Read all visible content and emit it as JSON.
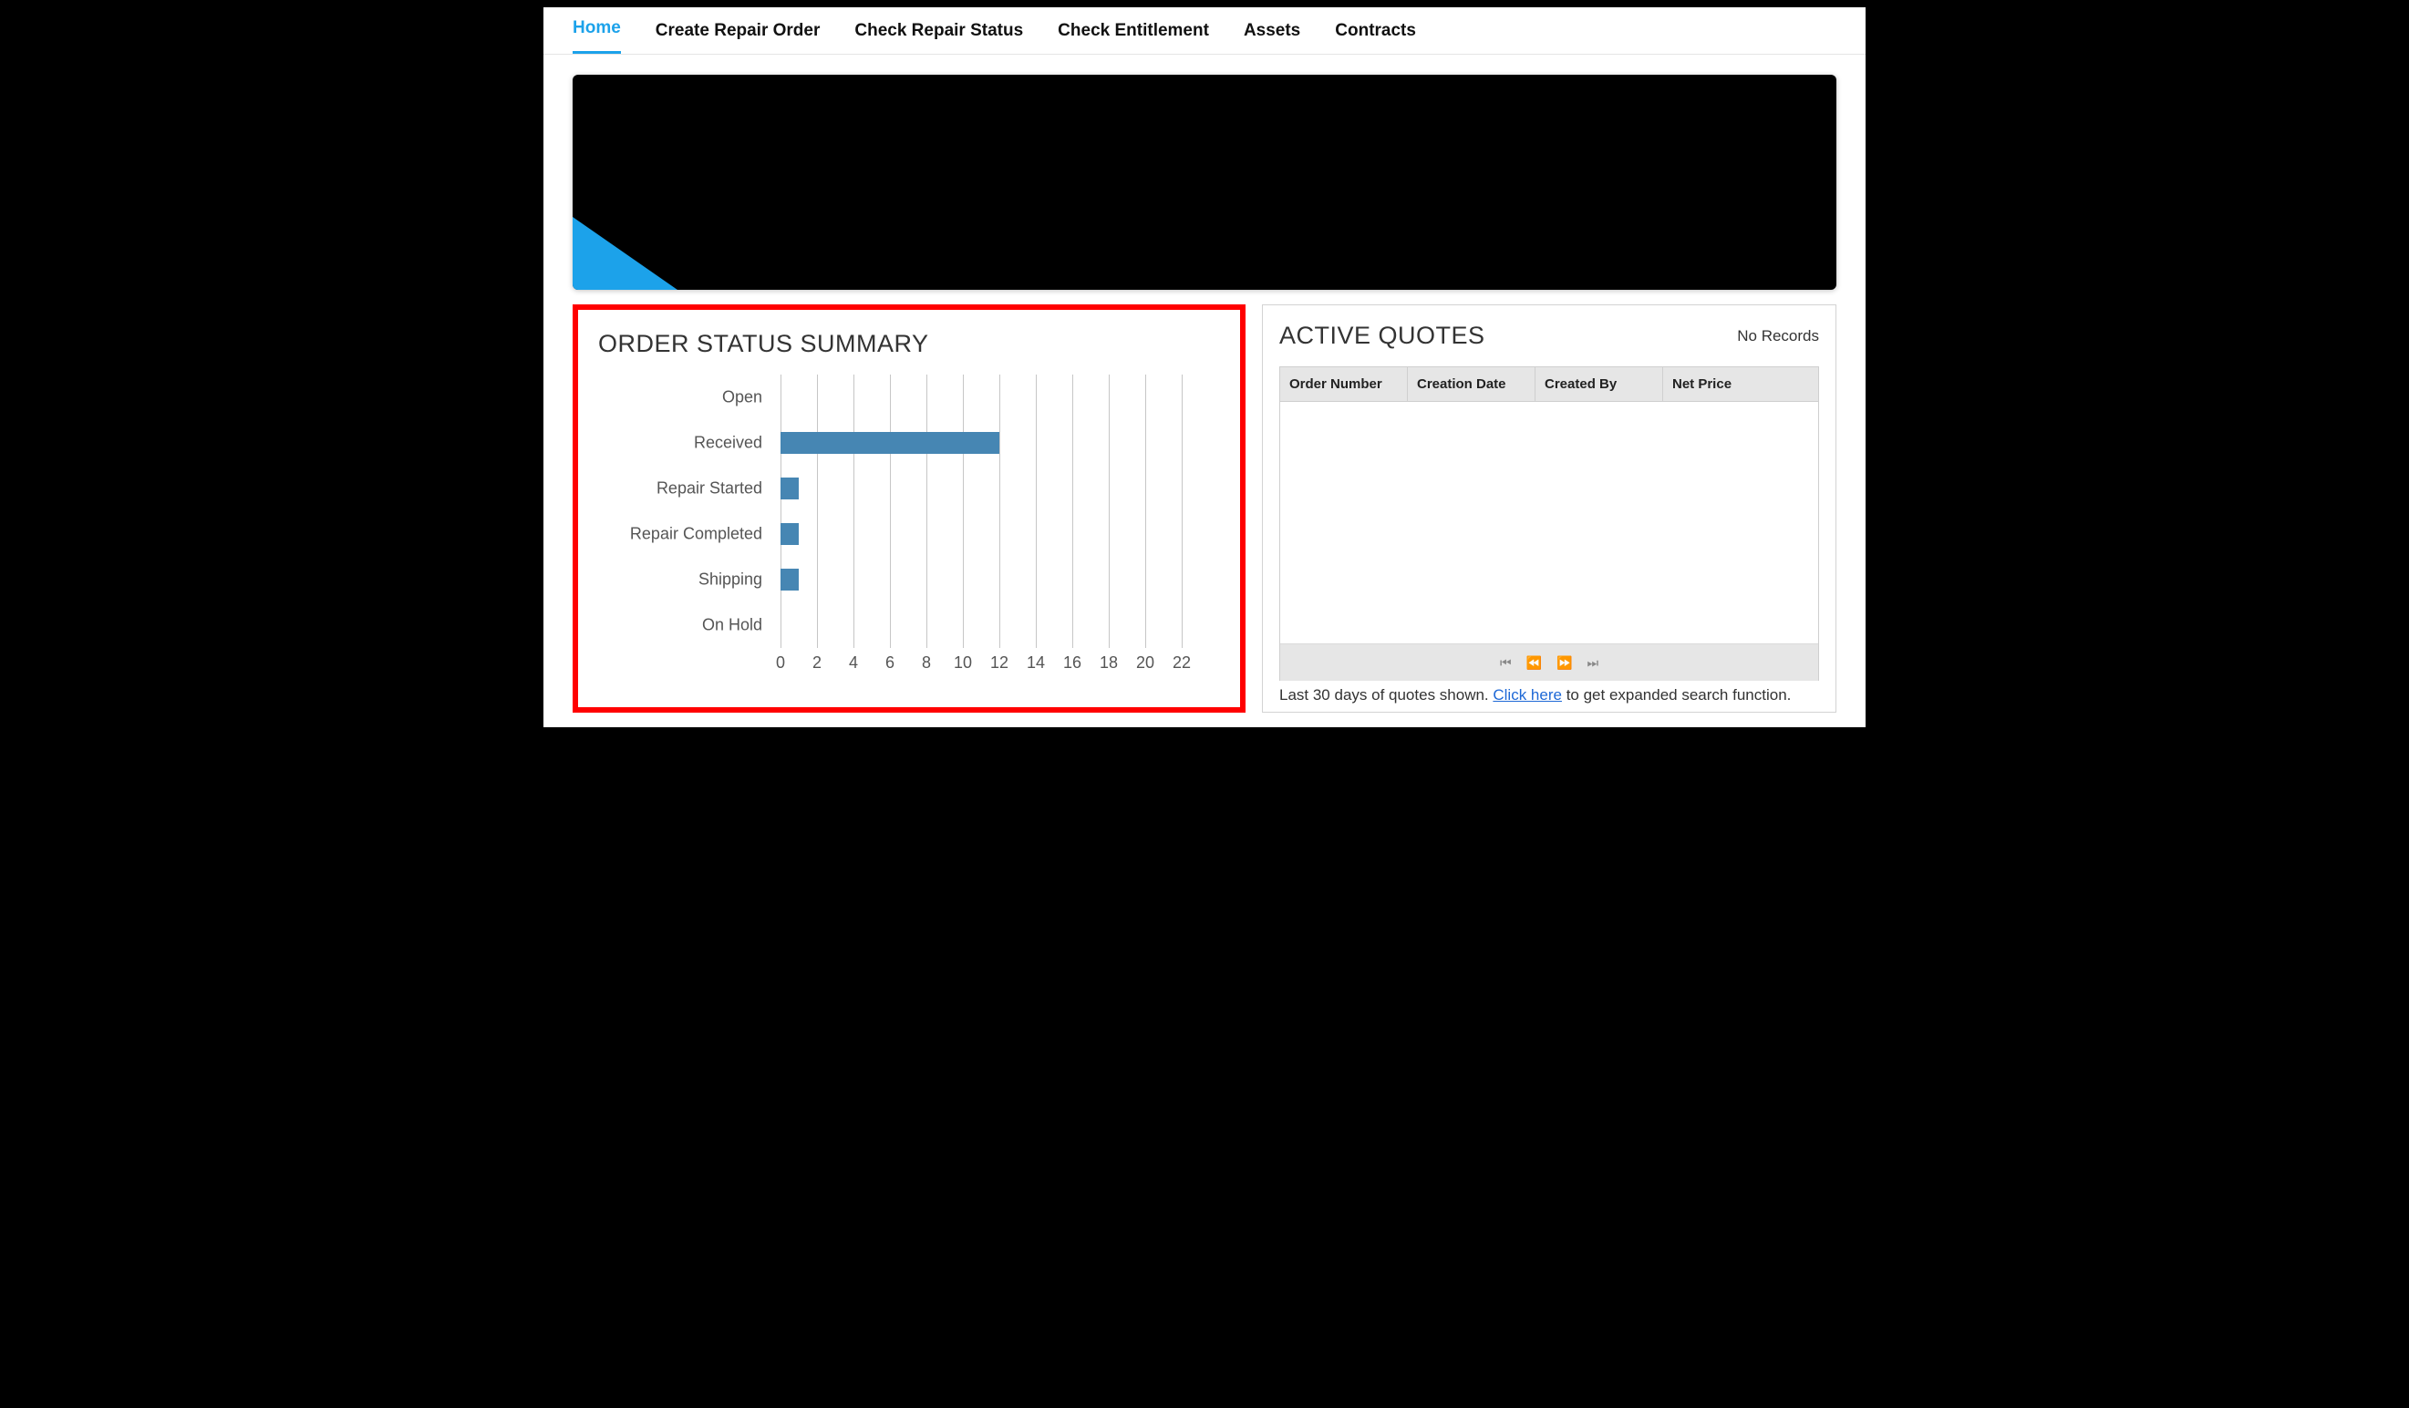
{
  "nav": {
    "items": [
      {
        "label": "Home",
        "active": true
      },
      {
        "label": "Create Repair Order",
        "active": false
      },
      {
        "label": "Check Repair Status",
        "active": false
      },
      {
        "label": "Check Entitlement",
        "active": false
      },
      {
        "label": "Assets",
        "active": false
      },
      {
        "label": "Contracts",
        "active": false
      }
    ]
  },
  "summary": {
    "title": "ORDER STATUS SUMMARY"
  },
  "quotes": {
    "title": "ACTIVE QUOTES",
    "no_records": "No Records",
    "columns": {
      "order": "Order Number",
      "date": "Creation Date",
      "created": "Created By",
      "price": "Net Price"
    },
    "footnote_prefix": "Last 30 days of quotes shown. ",
    "footnote_link": "Click here",
    "footnote_suffix": " to get expanded search function."
  },
  "chart_data": {
    "type": "bar",
    "orientation": "horizontal",
    "categories": [
      "Open",
      "Received",
      "Repair Started",
      "Repair Completed",
      "Shipping",
      "On Hold"
    ],
    "values": [
      0,
      12,
      1,
      1,
      1,
      0
    ],
    "x_ticks": [
      0,
      2,
      4,
      6,
      8,
      10,
      12,
      14,
      16,
      18,
      20,
      22
    ],
    "xlim": [
      0,
      22
    ],
    "bar_color": "#4686b3"
  }
}
